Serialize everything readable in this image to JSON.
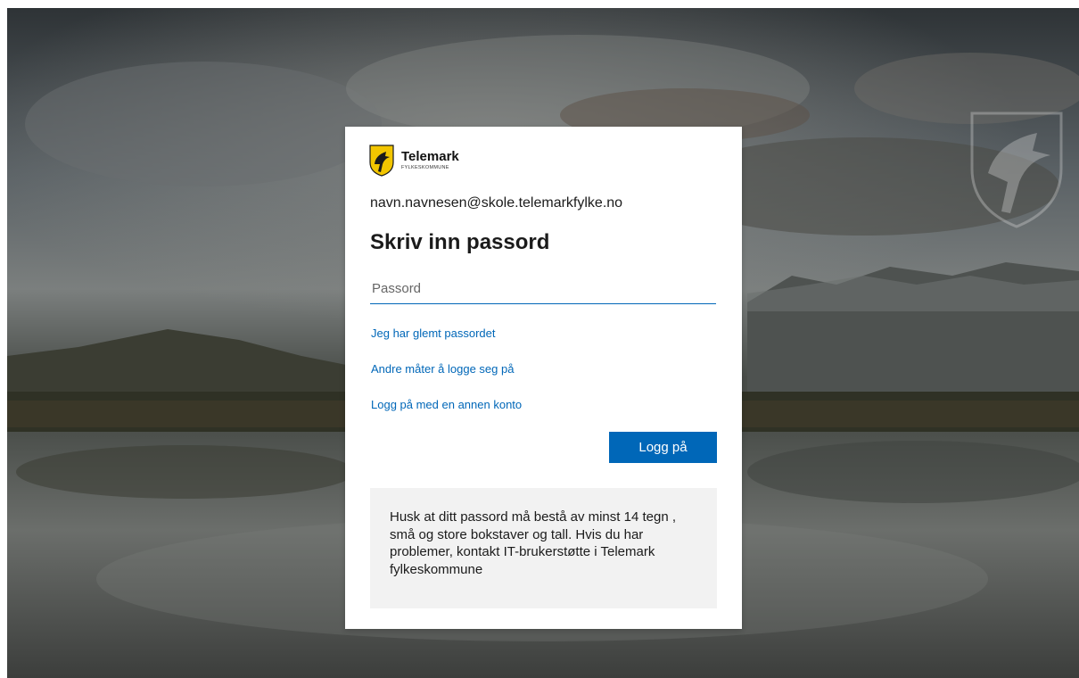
{
  "brand": {
    "name": "Telemark",
    "subtitle": "FYLKESKOMMUNE",
    "shield_color": "#f2c500"
  },
  "signin": {
    "identity": "navn.navnesen@skole.telemarkfylke.no",
    "heading": "Skriv inn passord",
    "password_placeholder": "Passord",
    "password_value": "",
    "links": {
      "forgot": "Jeg har glemt passordet",
      "other_ways": "Andre måter å logge seg på",
      "another_account": "Logg på med en annen konto"
    },
    "submit_label": "Logg på",
    "notice": "Husk at ditt passord må bestå av minst 14 tegn , små og store bokstaver og tall. Hvis du har problemer, kontakt IT-brukerstøtte i Telemark fylkeskommune"
  },
  "colors": {
    "accent": "#0067b8",
    "notice_bg": "#f2f2f2"
  }
}
